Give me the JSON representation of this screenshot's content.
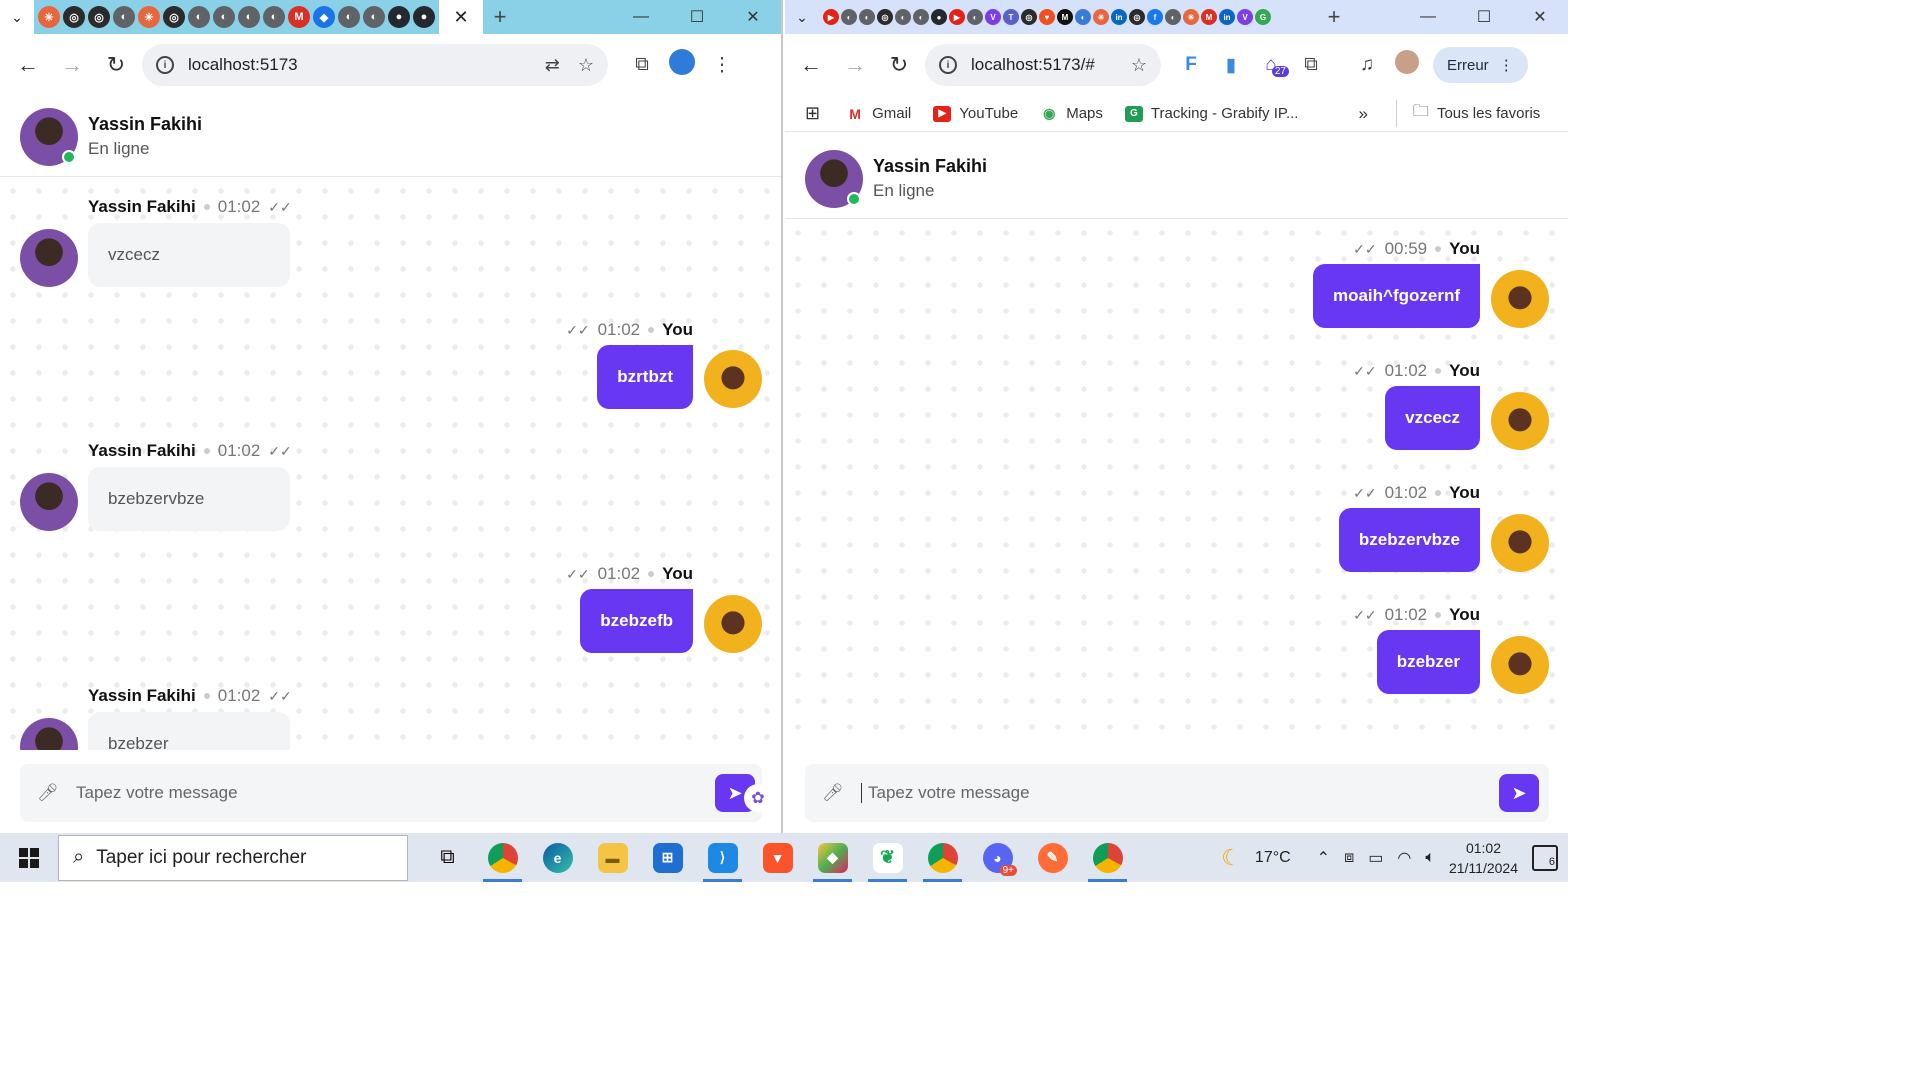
{
  "left_window": {
    "url": "localhost:5173",
    "header": {
      "name": "Yassin Fakihi",
      "status": "En ligne"
    },
    "messages": [
      {
        "sender": "Yassin Fakihi",
        "time": "01:02",
        "text": "vzcecz",
        "direction": "in"
      },
      {
        "sender": "You",
        "time": "01:02",
        "text": "bzrtbzt",
        "direction": "out"
      },
      {
        "sender": "Yassin Fakihi",
        "time": "01:02",
        "text": "bzebzervbze",
        "direction": "in"
      },
      {
        "sender": "You",
        "time": "01:02",
        "text": "bzebzefb",
        "direction": "out"
      },
      {
        "sender": "Yassin Fakihi",
        "time": "01:02",
        "text": "bzebzer",
        "direction": "in"
      }
    ],
    "composer_placeholder": "Tapez votre message"
  },
  "right_window": {
    "url": "localhost:5173/#",
    "profile_button": "Erreur",
    "extension_badge": "27",
    "bookmarks": [
      {
        "label": "Gmail",
        "icon": "gmail-icon"
      },
      {
        "label": "YouTube",
        "icon": "youtube-icon"
      },
      {
        "label": "Maps",
        "icon": "maps-icon"
      },
      {
        "label": "Tracking - Grabify IP...",
        "icon": "grabify-icon"
      }
    ],
    "all_bookmarks": "Tous les favoris",
    "header": {
      "name": "Yassin Fakihi",
      "status": "En ligne"
    },
    "messages": [
      {
        "sender": "You",
        "time": "00:59",
        "text": "moaih^fgozernf",
        "direction": "out"
      },
      {
        "sender": "You",
        "time": "01:02",
        "text": "vzcecz",
        "direction": "out"
      },
      {
        "sender": "You",
        "time": "01:02",
        "text": "bzebzervbze",
        "direction": "out"
      },
      {
        "sender": "You",
        "time": "01:02",
        "text": "bzebzer",
        "direction": "out"
      }
    ],
    "composer_placeholder": "Tapez votre message"
  },
  "taskbar": {
    "search_placeholder": "Taper ici pour rechercher",
    "apps": [
      "chrome-icon",
      "edge-icon",
      "file-explorer-icon",
      "store-icon",
      "vscode-icon",
      "brave-icon",
      "git-icon",
      "mongodb-icon",
      "chrome-profile-icon",
      "discord-icon",
      "postman-icon",
      "chrome-icon"
    ],
    "discord_badge": "9+",
    "weather": "17°C",
    "time": "01:02",
    "date": "21/11/2024",
    "notifications": "6"
  },
  "colors": {
    "accent": "#6737f2",
    "online": "#1fb85b"
  }
}
